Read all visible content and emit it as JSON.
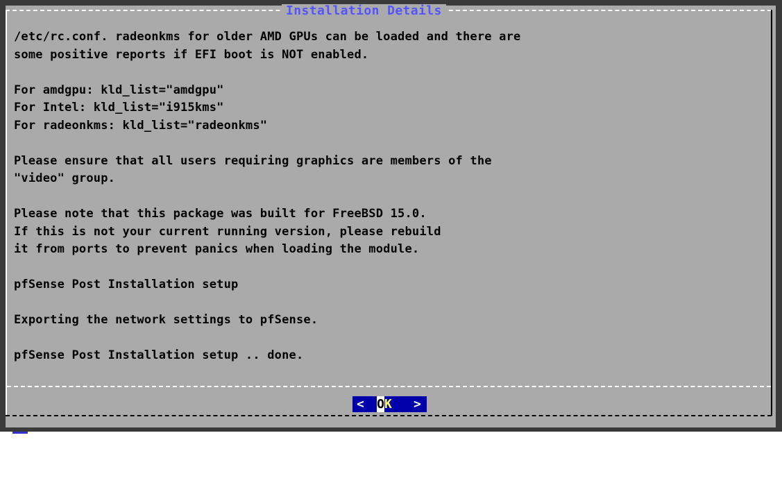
{
  "dialog": {
    "title": "Installation Details",
    "lines": [
      "/etc/rc.conf. radeonkms for older AMD GPUs can be loaded and there are",
      "some positive reports if EFI boot is NOT enabled.",
      "",
      "For amdgpu: kld_list=\"amdgpu\"",
      "For Intel: kld_list=\"i915kms\"",
      "For radeonkms: kld_list=\"radeonkms\"",
      "",
      "Please ensure that all users requiring graphics are members of the",
      "\"video\" group.",
      "",
      "Please note that this package was built for FreeBSD 15.0.",
      "If this is not your current running version, please rebuild",
      "it from ports to prevent panics when loading the module.",
      "",
      "pfSense Post Installation setup",
      "",
      "Exporting the network settings to pfSense.",
      "",
      "pfSense Post Installation setup .. done."
    ],
    "ok_button": {
      "left_bracket": "<",
      "hotkey": "O",
      "rest": "K",
      "right_bracket": ">"
    }
  },
  "colors": {
    "dialog_background": "#aaaaaa",
    "title_text": "#5555ff",
    "button_background": "#0000aa",
    "button_hotkey_text": "#ffff55"
  }
}
